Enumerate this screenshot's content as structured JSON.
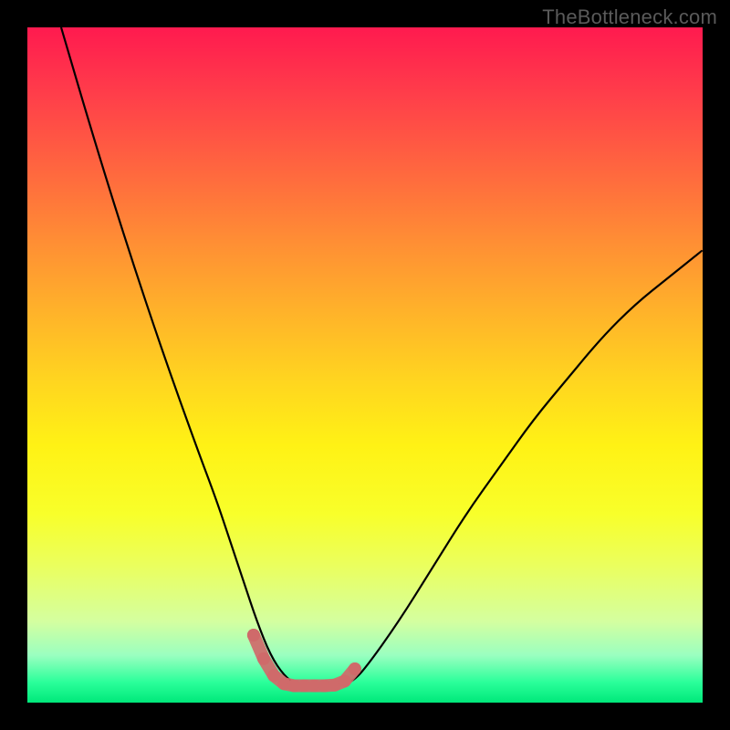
{
  "watermark": {
    "text": "TheBottleneck.com"
  },
  "colors": {
    "curve_stroke": "#000000",
    "marker_stroke": "#cf6a6a",
    "marker_fill": "#cf6a6a",
    "background": "#000000"
  },
  "chart_data": {
    "type": "line",
    "title": "",
    "xlabel": "",
    "ylabel": "",
    "xlim": [
      0,
      100
    ],
    "ylim": [
      0,
      100
    ],
    "grid": false,
    "series": [
      {
        "name": "bottleneck-curve",
        "x": [
          5,
          10,
          15,
          20,
          25,
          28,
          30,
          32,
          34,
          36,
          38,
          40,
          42,
          44,
          46,
          48,
          50,
          55,
          60,
          65,
          70,
          75,
          80,
          85,
          90,
          95,
          100
        ],
        "y": [
          100,
          83,
          67,
          52,
          38,
          30,
          24,
          18,
          12,
          7,
          4,
          2.5,
          2.5,
          2.5,
          2.5,
          3,
          5,
          12,
          20,
          28,
          35,
          42,
          48,
          54,
          59,
          63,
          67
        ]
      }
    ],
    "markers": {
      "name": "fit-markers",
      "x": [
        33.5,
        35,
        36.5,
        38,
        39.5,
        41,
        42.5,
        44,
        45.5,
        47,
        48.5
      ],
      "y": [
        10,
        6.5,
        4,
        2.8,
        2.5,
        2.5,
        2.5,
        2.5,
        2.6,
        3.2,
        5
      ]
    }
  }
}
